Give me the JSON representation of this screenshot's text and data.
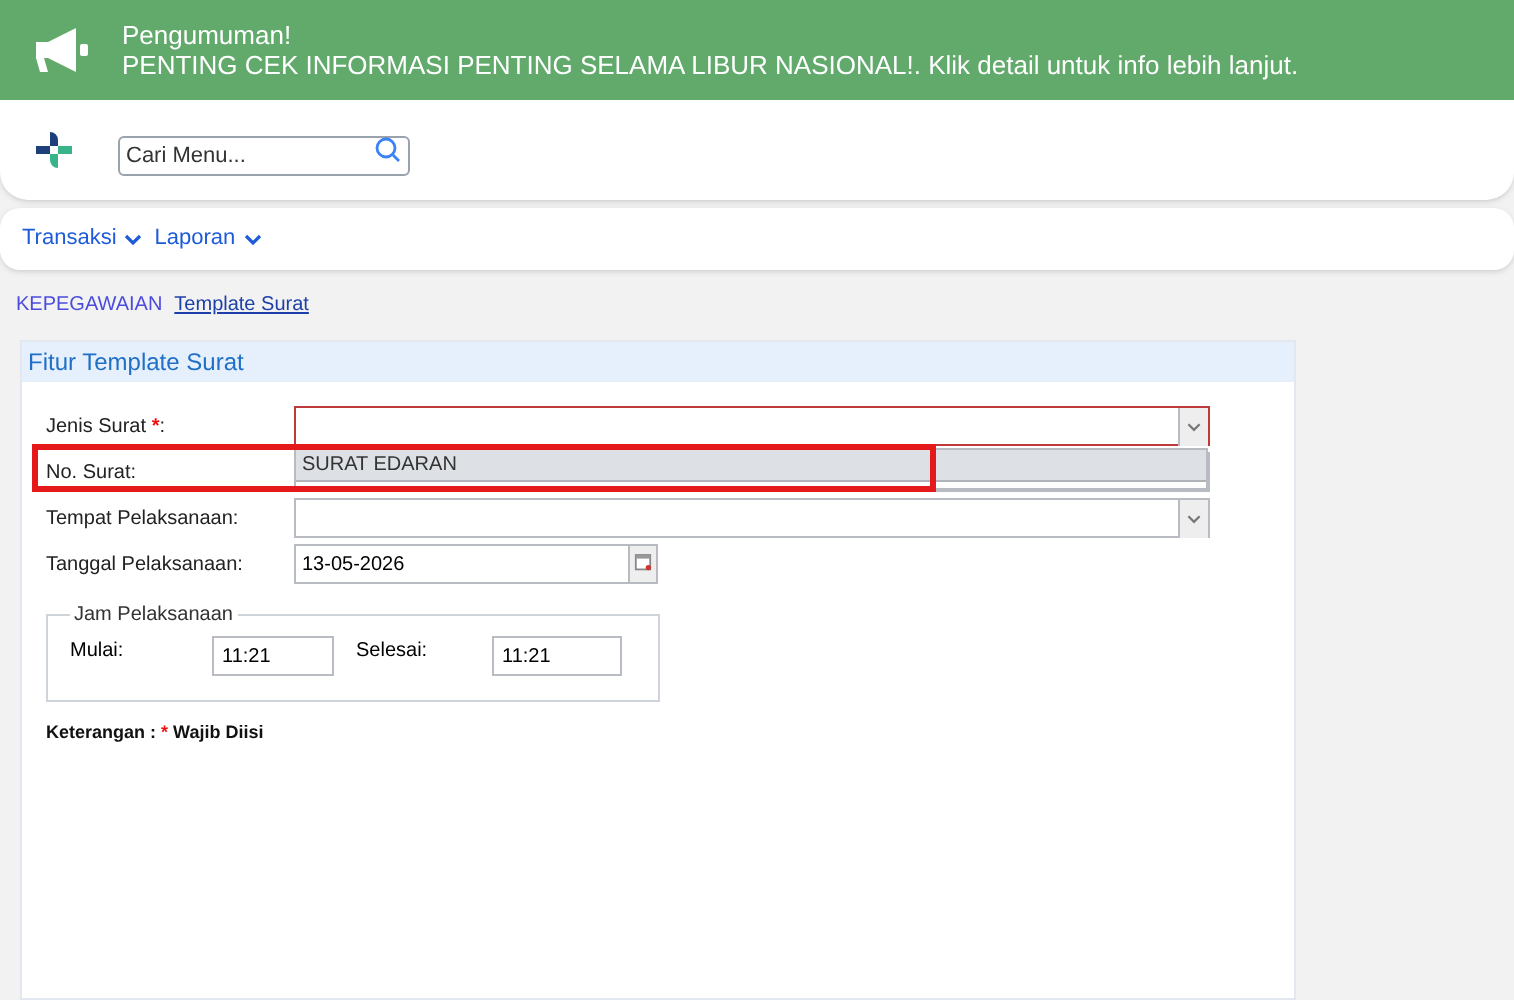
{
  "announcement": {
    "title": "Pengumuman!",
    "message": "PENTING CEK INFORMASI PENTING SELAMA LIBUR NASIONAL!. Klik detail untuk info lebih lanjut."
  },
  "search": {
    "placeholder": "Cari Menu..."
  },
  "nav": [
    {
      "label": "Transaksi"
    },
    {
      "label": "Laporan"
    }
  ],
  "breadcrumb": [
    {
      "label": "KEPEGAWAIAN",
      "current": false
    },
    {
      "label": "Template Surat",
      "current": true
    }
  ],
  "panel": {
    "title": "Fitur Template Surat",
    "fields": [
      {
        "kind": "select",
        "label": "Jenis Surat ",
        "required_mark": "*",
        "label_suffix": ":",
        "invalid": true,
        "options": [
          {
            "label": "SURAT EDARAN",
            "highlighted": true
          }
        ]
      },
      {
        "kind": "text",
        "label": "No. Surat:"
      },
      {
        "kind": "select",
        "label": "Tempat Pelaksanaan:",
        "invalid": false
      },
      {
        "kind": "date",
        "label": "Tanggal Pelaksanaan:",
        "value": "13-05-2026"
      }
    ],
    "time_group": {
      "legend": "Jam Pelaksanaan",
      "start_label": "Mulai:",
      "start": "11:21",
      "end_label": "Selesai:",
      "end": "11:21"
    },
    "note": {
      "label": "Keterangan : ",
      "required_mark": "*",
      "required_text": " Wajib Diisi"
    }
  },
  "annotation": {
    "highlight_option": true
  }
}
